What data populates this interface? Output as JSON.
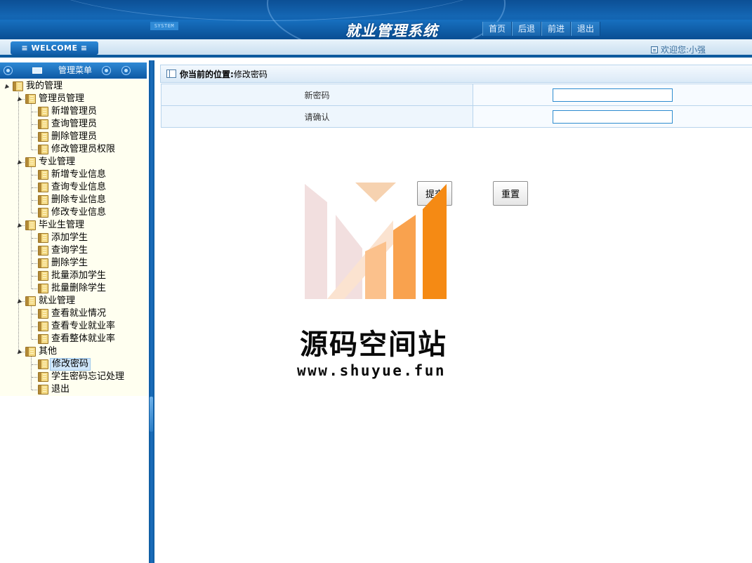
{
  "header": {
    "system_tag": "SYSTEM",
    "app_title": "就业管理系统",
    "nav": [
      "首页",
      "后退",
      "前进",
      "退出"
    ]
  },
  "welcome_bar": {
    "welcome_label": "≡ WELCOME ≡",
    "greeting": "欢迎您:小强"
  },
  "sidebar": {
    "title": "管理菜单",
    "tree": [
      {
        "label": "我的管理"
      },
      {
        "label": "管理员管理"
      },
      {
        "label": "新增管理员"
      },
      {
        "label": "查询管理员"
      },
      {
        "label": "删除管理员"
      },
      {
        "label": "修改管理员权限"
      },
      {
        "label": "专业管理"
      },
      {
        "label": "新增专业信息"
      },
      {
        "label": "查询专业信息"
      },
      {
        "label": "删除专业信息"
      },
      {
        "label": "修改专业信息"
      },
      {
        "label": "毕业生管理"
      },
      {
        "label": "添加学生"
      },
      {
        "label": "查询学生"
      },
      {
        "label": "删除学生"
      },
      {
        "label": "批量添加学生"
      },
      {
        "label": "批量删除学生"
      },
      {
        "label": "就业管理"
      },
      {
        "label": "查看就业情况"
      },
      {
        "label": "查看专业就业率"
      },
      {
        "label": "查看整体就业率"
      },
      {
        "label": "其他"
      },
      {
        "label": "修改密码"
      },
      {
        "label": "学生密码忘记处理"
      },
      {
        "label": "退出"
      }
    ],
    "selected": "修改密码"
  },
  "main": {
    "breadcrumb_label": "你当前的位置:",
    "breadcrumb_value": "修改密码",
    "form": {
      "new_password_label": "新密码",
      "new_password_value": "",
      "confirm_label": "请确认",
      "confirm_value": ""
    },
    "submit_label": "提交",
    "reset_label": "重置"
  },
  "watermark": {
    "title": "源码空间站",
    "url": "www.shuyue.fun"
  }
}
